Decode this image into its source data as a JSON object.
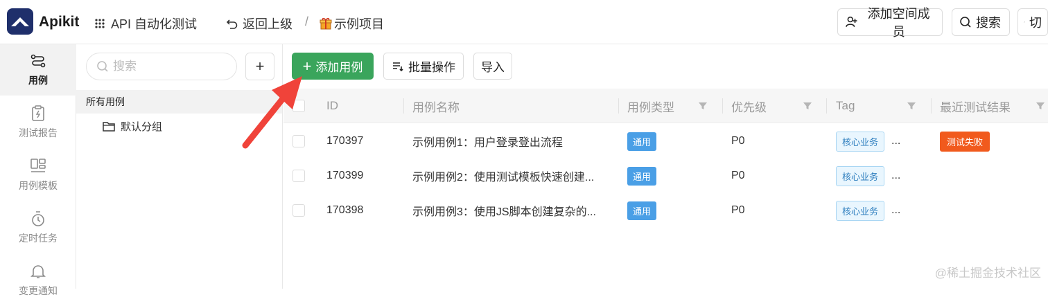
{
  "header": {
    "brand": "Apikit",
    "workspace": "API 自动化测试",
    "back_label": "返回上级",
    "separator": "/",
    "project_name": "示例项目",
    "add_member_label": "添加空间成员",
    "search_label": "搜索",
    "more_label": "切"
  },
  "sidenav": {
    "items": [
      {
        "label": "用例",
        "icon": "route-icon",
        "active": true
      },
      {
        "label": "测试报告",
        "icon": "report-icon"
      },
      {
        "label": "用例模板",
        "icon": "template-icon"
      },
      {
        "label": "定时任务",
        "icon": "timer-icon"
      },
      {
        "label": "变更通知",
        "icon": "bell-icon"
      }
    ]
  },
  "tree": {
    "search_placeholder": "搜索",
    "add_label": "+",
    "all_cases": "所有用例",
    "groups": [
      "默认分组"
    ]
  },
  "toolbar": {
    "add_case_label": "添加用例",
    "bulk_label": "批量操作",
    "import_label": "导入"
  },
  "table": {
    "columns": [
      "ID",
      "用例名称",
      "用例类型",
      "优先级",
      "Tag",
      "最近测试结果"
    ],
    "rows": [
      {
        "id": "170397",
        "name": "示例用例1：用户登录登出流程",
        "type": "通用",
        "priority": "P0",
        "tag": "核心业务",
        "more": "...",
        "result": "测试失败"
      },
      {
        "id": "170399",
        "name": "示例用例2：使用测试模板快速创建...",
        "type": "通用",
        "priority": "P0",
        "tag": "核心业务",
        "more": "...",
        "result": ""
      },
      {
        "id": "170398",
        "name": "示例用例3：使用JS脚本创建复杂的...",
        "type": "通用",
        "priority": "P0",
        "tag": "核心业务",
        "more": "...",
        "result": ""
      }
    ]
  },
  "watermark": "@稀土掘金技术社区",
  "colors": {
    "brand": "#1f2f6b",
    "primary_green": "#3aa55c",
    "type_badge": "#4a9fe6",
    "fail_badge": "#f15a1d",
    "arrow": "#f0433a"
  }
}
